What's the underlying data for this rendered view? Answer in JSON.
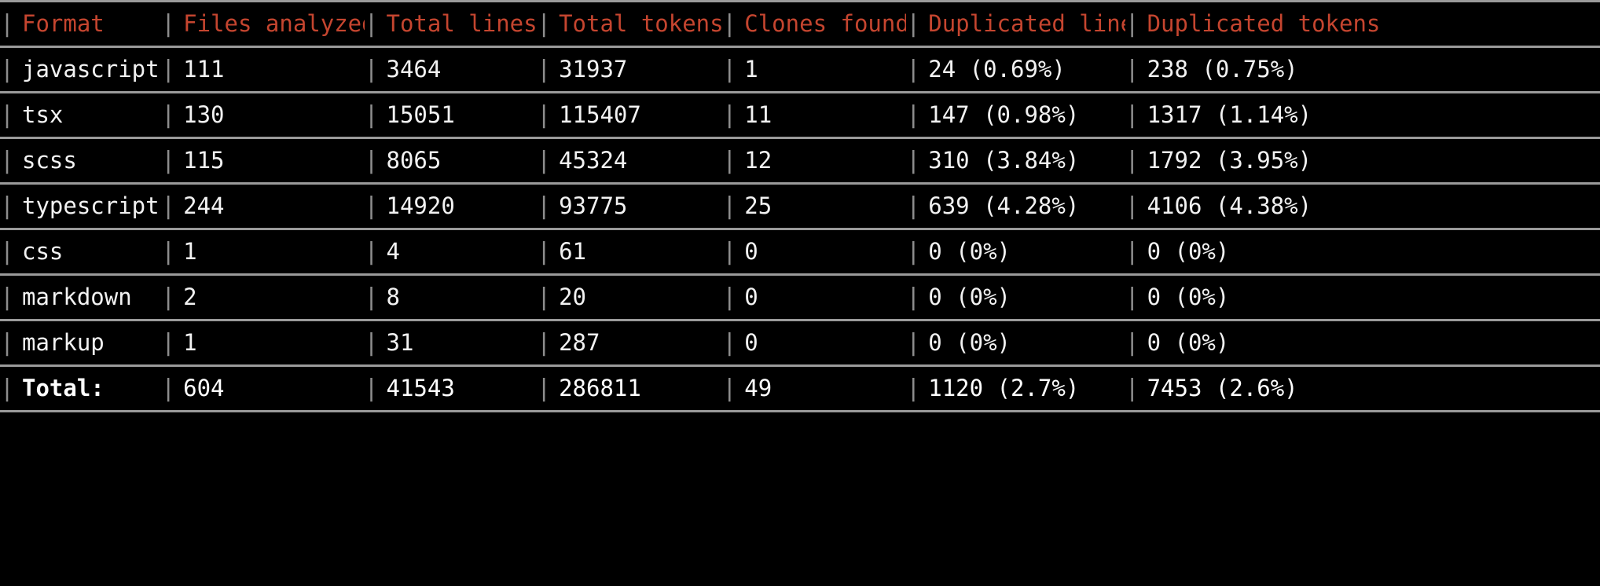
{
  "terminal": {
    "background": "#000000",
    "header_color": "#c5452f",
    "body_color": "#f2f2f2",
    "rule_color": "#9a9a9a",
    "pipe_char": "|"
  },
  "table": {
    "headers": [
      "Format",
      "Files analyzed",
      "Total lines",
      "Total tokens",
      "Clones found",
      "Duplicated lines",
      "Duplicated tokens"
    ],
    "rows": [
      {
        "format": "javascript",
        "files_analyzed": "111",
        "total_lines": "3464",
        "total_tokens": "31937",
        "clones_found": "1",
        "duplicated_lines": "24 (0.69%)",
        "duplicated_tokens": "238 (0.75%)"
      },
      {
        "format": "tsx",
        "files_analyzed": "130",
        "total_lines": "15051",
        "total_tokens": "115407",
        "clones_found": "11",
        "duplicated_lines": "147 (0.98%)",
        "duplicated_tokens": "1317 (1.14%)"
      },
      {
        "format": "scss",
        "files_analyzed": "115",
        "total_lines": "8065",
        "total_tokens": "45324",
        "clones_found": "12",
        "duplicated_lines": "310 (3.84%)",
        "duplicated_tokens": "1792 (3.95%)"
      },
      {
        "format": "typescript",
        "files_analyzed": "244",
        "total_lines": "14920",
        "total_tokens": "93775",
        "clones_found": "25",
        "duplicated_lines": "639 (4.28%)",
        "duplicated_tokens": "4106 (4.38%)"
      },
      {
        "format": "css",
        "files_analyzed": "1",
        "total_lines": "4",
        "total_tokens": "61",
        "clones_found": "0",
        "duplicated_lines": "0 (0%)",
        "duplicated_tokens": "0 (0%)"
      },
      {
        "format": "markdown",
        "files_analyzed": "2",
        "total_lines": "8",
        "total_tokens": "20",
        "clones_found": "0",
        "duplicated_lines": "0 (0%)",
        "duplicated_tokens": "0 (0%)"
      },
      {
        "format": "markup",
        "files_analyzed": "1",
        "total_lines": "31",
        "total_tokens": "287",
        "clones_found": "0",
        "duplicated_lines": "0 (0%)",
        "duplicated_tokens": "0 (0%)"
      }
    ],
    "total": {
      "format": "Total:",
      "files_analyzed": "604",
      "total_lines": "41543",
      "total_tokens": "286811",
      "clones_found": "49",
      "duplicated_lines": "1120 (2.7%)",
      "duplicated_tokens": "7453 (2.6%)"
    }
  }
}
